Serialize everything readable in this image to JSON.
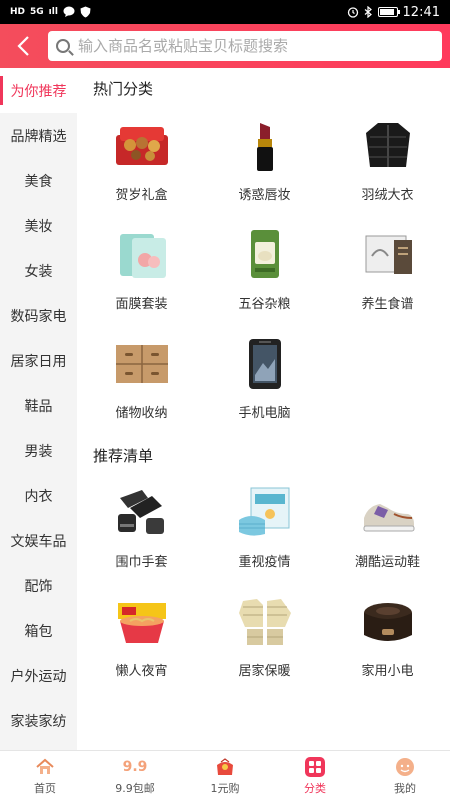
{
  "status_bar": {
    "left_chips": [
      "HD",
      "5G",
      "ıll"
    ],
    "time": "12:41"
  },
  "header": {
    "search_placeholder": "输入商品名或粘贴宝贝标题搜索"
  },
  "sidebar": {
    "items": [
      {
        "label": "为你推荐",
        "active": true
      },
      {
        "label": "品牌精选"
      },
      {
        "label": "美食"
      },
      {
        "label": "美妆"
      },
      {
        "label": "女装"
      },
      {
        "label": "数码家电"
      },
      {
        "label": "居家日用"
      },
      {
        "label": "鞋品"
      },
      {
        "label": "男装"
      },
      {
        "label": "内衣"
      },
      {
        "label": "文娱车品"
      },
      {
        "label": "配饰"
      },
      {
        "label": "箱包"
      },
      {
        "label": "户外运动"
      },
      {
        "label": "家装家纺"
      }
    ]
  },
  "sections": [
    {
      "title": "热门分类",
      "items": [
        {
          "label": "贺岁礼盒",
          "icon": "gift-box-icon"
        },
        {
          "label": "诱惑唇妆",
          "icon": "lipstick-icon"
        },
        {
          "label": "羽绒大衣",
          "icon": "down-jacket-icon"
        },
        {
          "label": "面膜套装",
          "icon": "face-mask-icon"
        },
        {
          "label": "五谷杂粮",
          "icon": "rice-bag-icon"
        },
        {
          "label": "养生食谱",
          "icon": "recipe-book-icon"
        },
        {
          "label": "储物收纳",
          "icon": "storage-drawer-icon"
        },
        {
          "label": "手机电脑",
          "icon": "phone-icon"
        }
      ]
    },
    {
      "title": "推荐清单",
      "items": [
        {
          "label": "围巾手套",
          "icon": "scarf-icon"
        },
        {
          "label": "重视疫情",
          "icon": "medical-mask-icon"
        },
        {
          "label": "潮酷运动鞋",
          "icon": "sneaker-icon"
        },
        {
          "label": "懒人夜宵",
          "icon": "instant-noodles-icon"
        },
        {
          "label": "居家保暖",
          "icon": "pajamas-icon"
        },
        {
          "label": "家用小电",
          "icon": "rice-cooker-icon"
        }
      ]
    }
  ],
  "tabbar": {
    "items": [
      {
        "label": "首页",
        "icon": "home-icon"
      },
      {
        "label": "9.9包邮",
        "icon": "nine-nine-icon",
        "icon_text": "9.9"
      },
      {
        "label": "1元购",
        "icon": "red-envelope-icon"
      },
      {
        "label": "分类",
        "icon": "category-icon",
        "active": true
      },
      {
        "label": "我的",
        "icon": "profile-icon"
      }
    ]
  },
  "colors": {
    "accent": "#f0365a",
    "header_gradient_start": "#f44d5c",
    "sidebar_bg": "#f4f4f4"
  }
}
